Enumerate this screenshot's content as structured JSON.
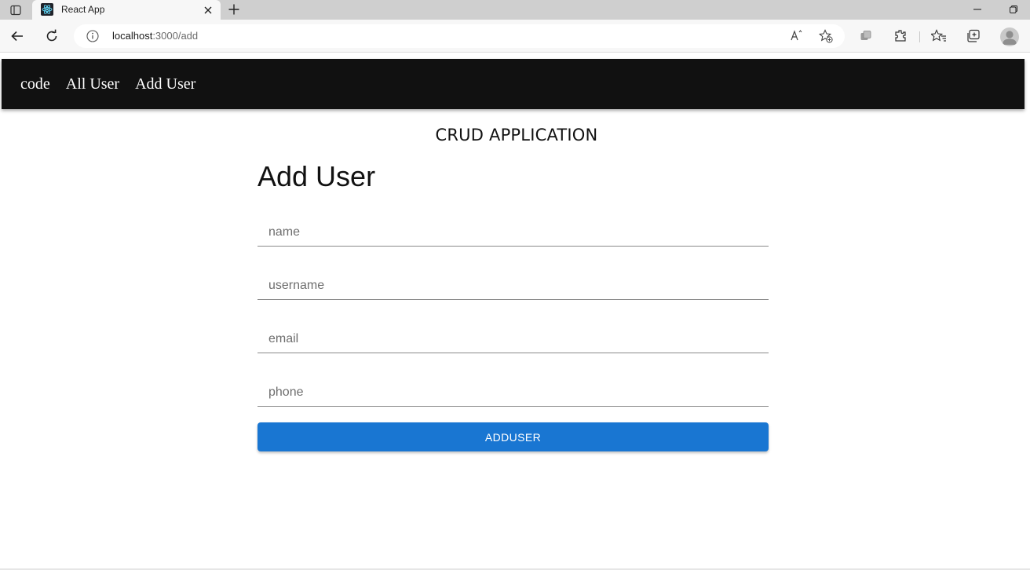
{
  "browser": {
    "tab_title": "React App",
    "url_host": "localhost",
    "url_path": ":3000/add",
    "icons": {
      "tab_actions": "tab-actions-icon",
      "favicon": "react-logo-icon",
      "tab_close": "close-icon",
      "new_tab": "plus-icon",
      "minimize": "minimize-icon",
      "restore": "restore-icon",
      "back": "back-arrow-icon",
      "refresh": "refresh-icon",
      "site_info": "info-icon",
      "read_aloud": "read-aloud-icon",
      "add_favorite": "add-favorite-icon",
      "workspaces": "workspaces-icon",
      "extensions": "extensions-icon",
      "favorites": "favorites-icon",
      "collections": "collections-icon",
      "profile": "profile-avatar-icon"
    }
  },
  "navbar": {
    "items": [
      {
        "label": "code"
      },
      {
        "label": "All User"
      },
      {
        "label": "Add User"
      }
    ],
    "background": "#111111"
  },
  "page": {
    "heading": "CRUD APPLICATION",
    "form_title": "Add User",
    "fields": [
      {
        "placeholder": "name",
        "value": ""
      },
      {
        "placeholder": "username",
        "value": ""
      },
      {
        "placeholder": "email",
        "value": ""
      },
      {
        "placeholder": "phone",
        "value": ""
      }
    ],
    "submit_label": "ADDUSER",
    "accent": "#1976d2"
  }
}
